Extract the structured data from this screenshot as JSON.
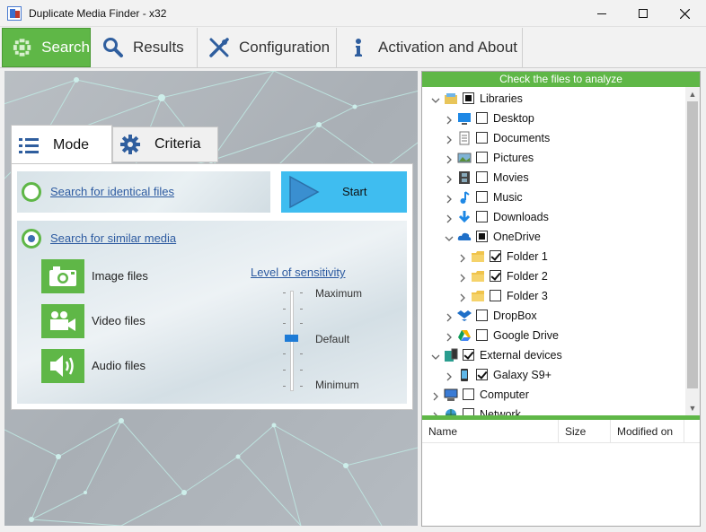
{
  "window": {
    "title": "Duplicate Media Finder - x32"
  },
  "main_tabs": [
    {
      "label": "Search",
      "icon": "search-grid-icon",
      "active": true
    },
    {
      "label": "Results",
      "icon": "magnifier-icon",
      "active": false
    },
    {
      "label": "Configuration",
      "icon": "wrench-icon",
      "active": false
    },
    {
      "label": "Activation and About",
      "icon": "info-icon",
      "active": false
    }
  ],
  "sub_tabs": [
    {
      "label": "Mode",
      "icon": "list-icon",
      "active": true
    },
    {
      "label": "Criteria",
      "icon": "gear-icon",
      "active": false
    }
  ],
  "mode": {
    "identical_label": "Search for identical files",
    "similar_label": "Search for similar media",
    "selected": "similar",
    "start_label": "Start",
    "media_types": [
      {
        "label": "Image files",
        "icon": "camera-icon"
      },
      {
        "label": "Video files",
        "icon": "video-camera-icon"
      },
      {
        "label": "Audio files",
        "icon": "speaker-icon"
      }
    ],
    "sensitivity": {
      "label": "Level of sensitivity",
      "max_label": "Maximum",
      "default_label": "Default",
      "min_label": "Minimum",
      "value": "Default"
    }
  },
  "file_panel": {
    "header": "Check the files to analyze",
    "tree": [
      {
        "label": "Libraries",
        "icon": "libraries-icon",
        "check": "partial",
        "expanded": true,
        "level": 0
      },
      {
        "label": "Desktop",
        "icon": "desktop-icon",
        "check": "unchecked",
        "expanded": false,
        "level": 1
      },
      {
        "label": "Documents",
        "icon": "documents-icon",
        "check": "unchecked",
        "expanded": false,
        "level": 1
      },
      {
        "label": "Pictures",
        "icon": "pictures-icon",
        "check": "unchecked",
        "expanded": false,
        "level": 1
      },
      {
        "label": "Movies",
        "icon": "film-icon",
        "check": "unchecked",
        "expanded": false,
        "level": 1
      },
      {
        "label": "Music",
        "icon": "music-note-icon",
        "check": "unchecked",
        "expanded": false,
        "level": 1
      },
      {
        "label": "Downloads",
        "icon": "download-arrow-icon",
        "check": "unchecked",
        "expanded": false,
        "level": 1
      },
      {
        "label": "OneDrive",
        "icon": "onedrive-cloud-icon",
        "check": "partial",
        "expanded": true,
        "level": 1
      },
      {
        "label": "Folder 1",
        "icon": "folder-icon",
        "check": "checked",
        "expanded": false,
        "level": 2
      },
      {
        "label": "Folder 2",
        "icon": "folder-icon",
        "check": "checked",
        "expanded": false,
        "level": 2
      },
      {
        "label": "Folder 3",
        "icon": "folder-icon",
        "check": "unchecked",
        "expanded": false,
        "level": 2
      },
      {
        "label": "DropBox",
        "icon": "dropbox-icon",
        "check": "unchecked",
        "expanded": false,
        "level": 1
      },
      {
        "label": "Google Drive",
        "icon": "google-drive-icon",
        "check": "unchecked",
        "expanded": false,
        "level": 1
      },
      {
        "label": "External devices",
        "icon": "phone-device-icon",
        "check": "checked",
        "expanded": true,
        "level": 0
      },
      {
        "label": "Galaxy S9+",
        "icon": "phone-icon",
        "check": "checked",
        "expanded": false,
        "level": 1
      },
      {
        "label": "Computer",
        "icon": "computer-icon",
        "check": "unchecked",
        "expanded": false,
        "level": 0
      },
      {
        "label": "Network",
        "icon": "network-globe-icon",
        "check": "unchecked",
        "expanded": false,
        "level": 0
      }
    ],
    "columns": [
      "Name",
      "Size",
      "Modified on"
    ]
  },
  "colors": {
    "accent_green": "#5fb747",
    "start_blue": "#3fbdf0",
    "link_blue": "#2c5aa0"
  }
}
